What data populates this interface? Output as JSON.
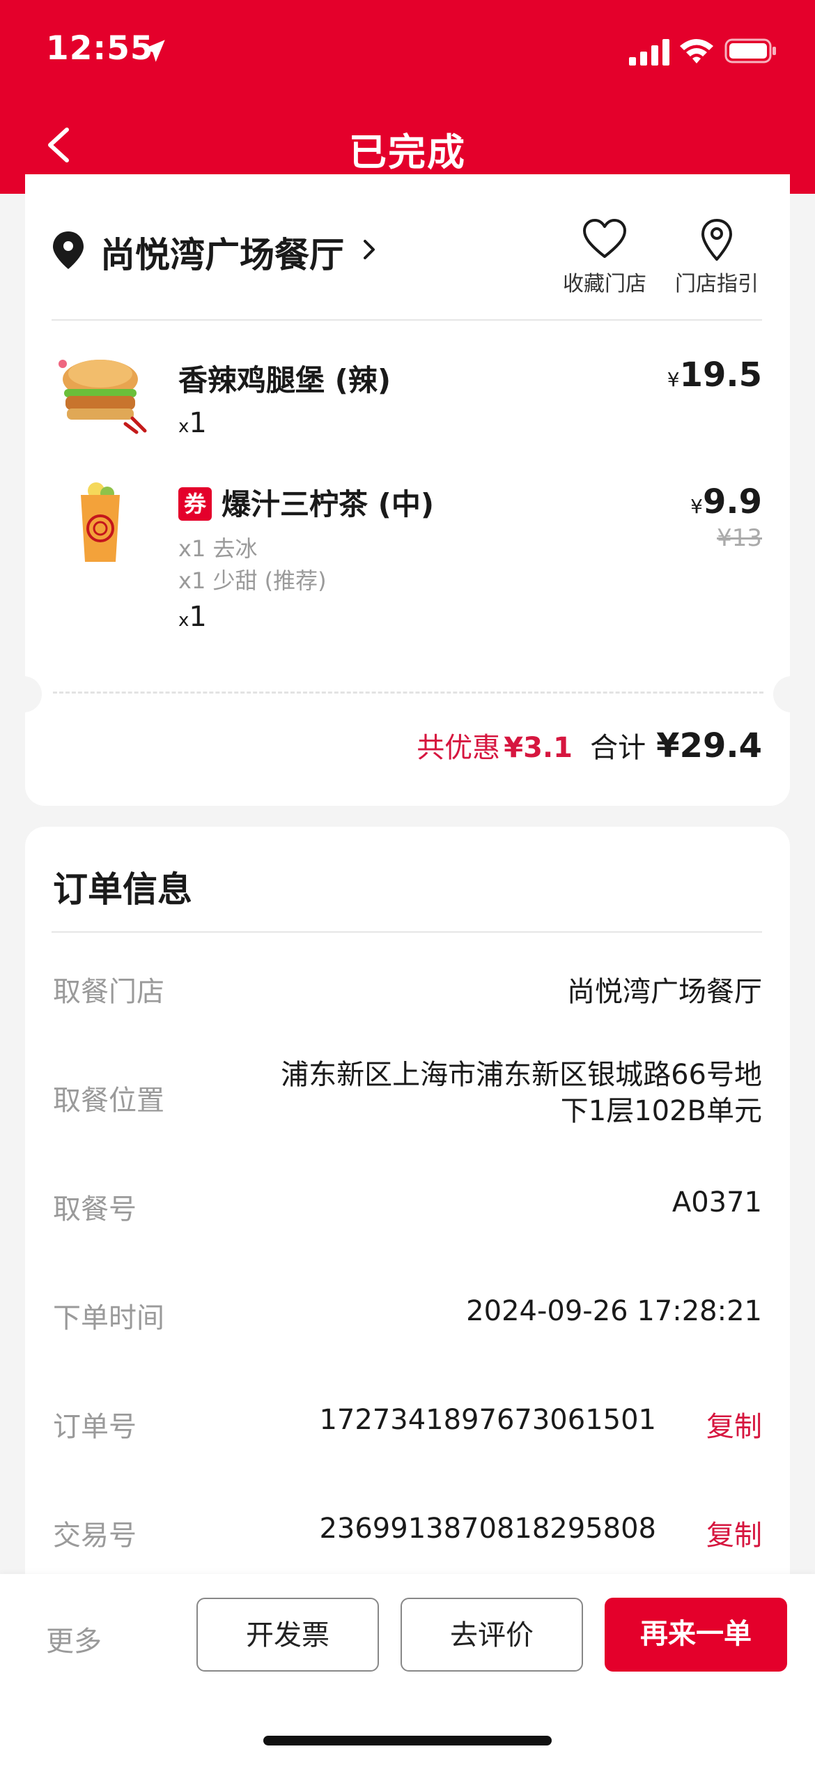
{
  "status_bar": {
    "time": "12:55"
  },
  "header": {
    "title": "已完成"
  },
  "store": {
    "name": "尚悦湾广场餐厅",
    "favorite_label": "收藏门店",
    "guide_label": "门店指引"
  },
  "items": [
    {
      "name": "香辣鸡腿堡 (辣)",
      "qty_prefix": "x",
      "qty": "1",
      "currency": "¥",
      "price": "19.5"
    },
    {
      "badge": "券",
      "name": "爆汁三柠茶 (中)",
      "options": [
        "x1 去冰",
        "x1 少甜 (推荐)"
      ],
      "qty_prefix": "x",
      "qty": "1",
      "currency": "¥",
      "price": "9.9",
      "original_price": "¥13"
    }
  ],
  "summary": {
    "discount_label": "共优惠",
    "discount_value": "¥3.1",
    "total_label": "合计",
    "total_value": "¥29.4"
  },
  "order_info": {
    "heading": "订单信息",
    "rows": [
      {
        "label": "取餐门店",
        "value": "尚悦湾广场餐厅"
      },
      {
        "label": "取餐位置",
        "value": "浦东新区上海市浦东新区银城路66号地下1层102B单元"
      },
      {
        "label": "取餐号",
        "value": "A0371"
      },
      {
        "label": "下单时间",
        "value": "2024-09-26 17:28:21"
      },
      {
        "label": "订单号",
        "value": "1727341897673061501",
        "action": "复制"
      },
      {
        "label": "交易号",
        "value": "2369913870818295808",
        "action": "复制"
      }
    ]
  },
  "bottom_bar": {
    "more": "更多",
    "invoice": "开发票",
    "review": "去评价",
    "reorder": "再来一单"
  },
  "colors": {
    "brand": "#e4002b",
    "discount": "#d6163f"
  }
}
